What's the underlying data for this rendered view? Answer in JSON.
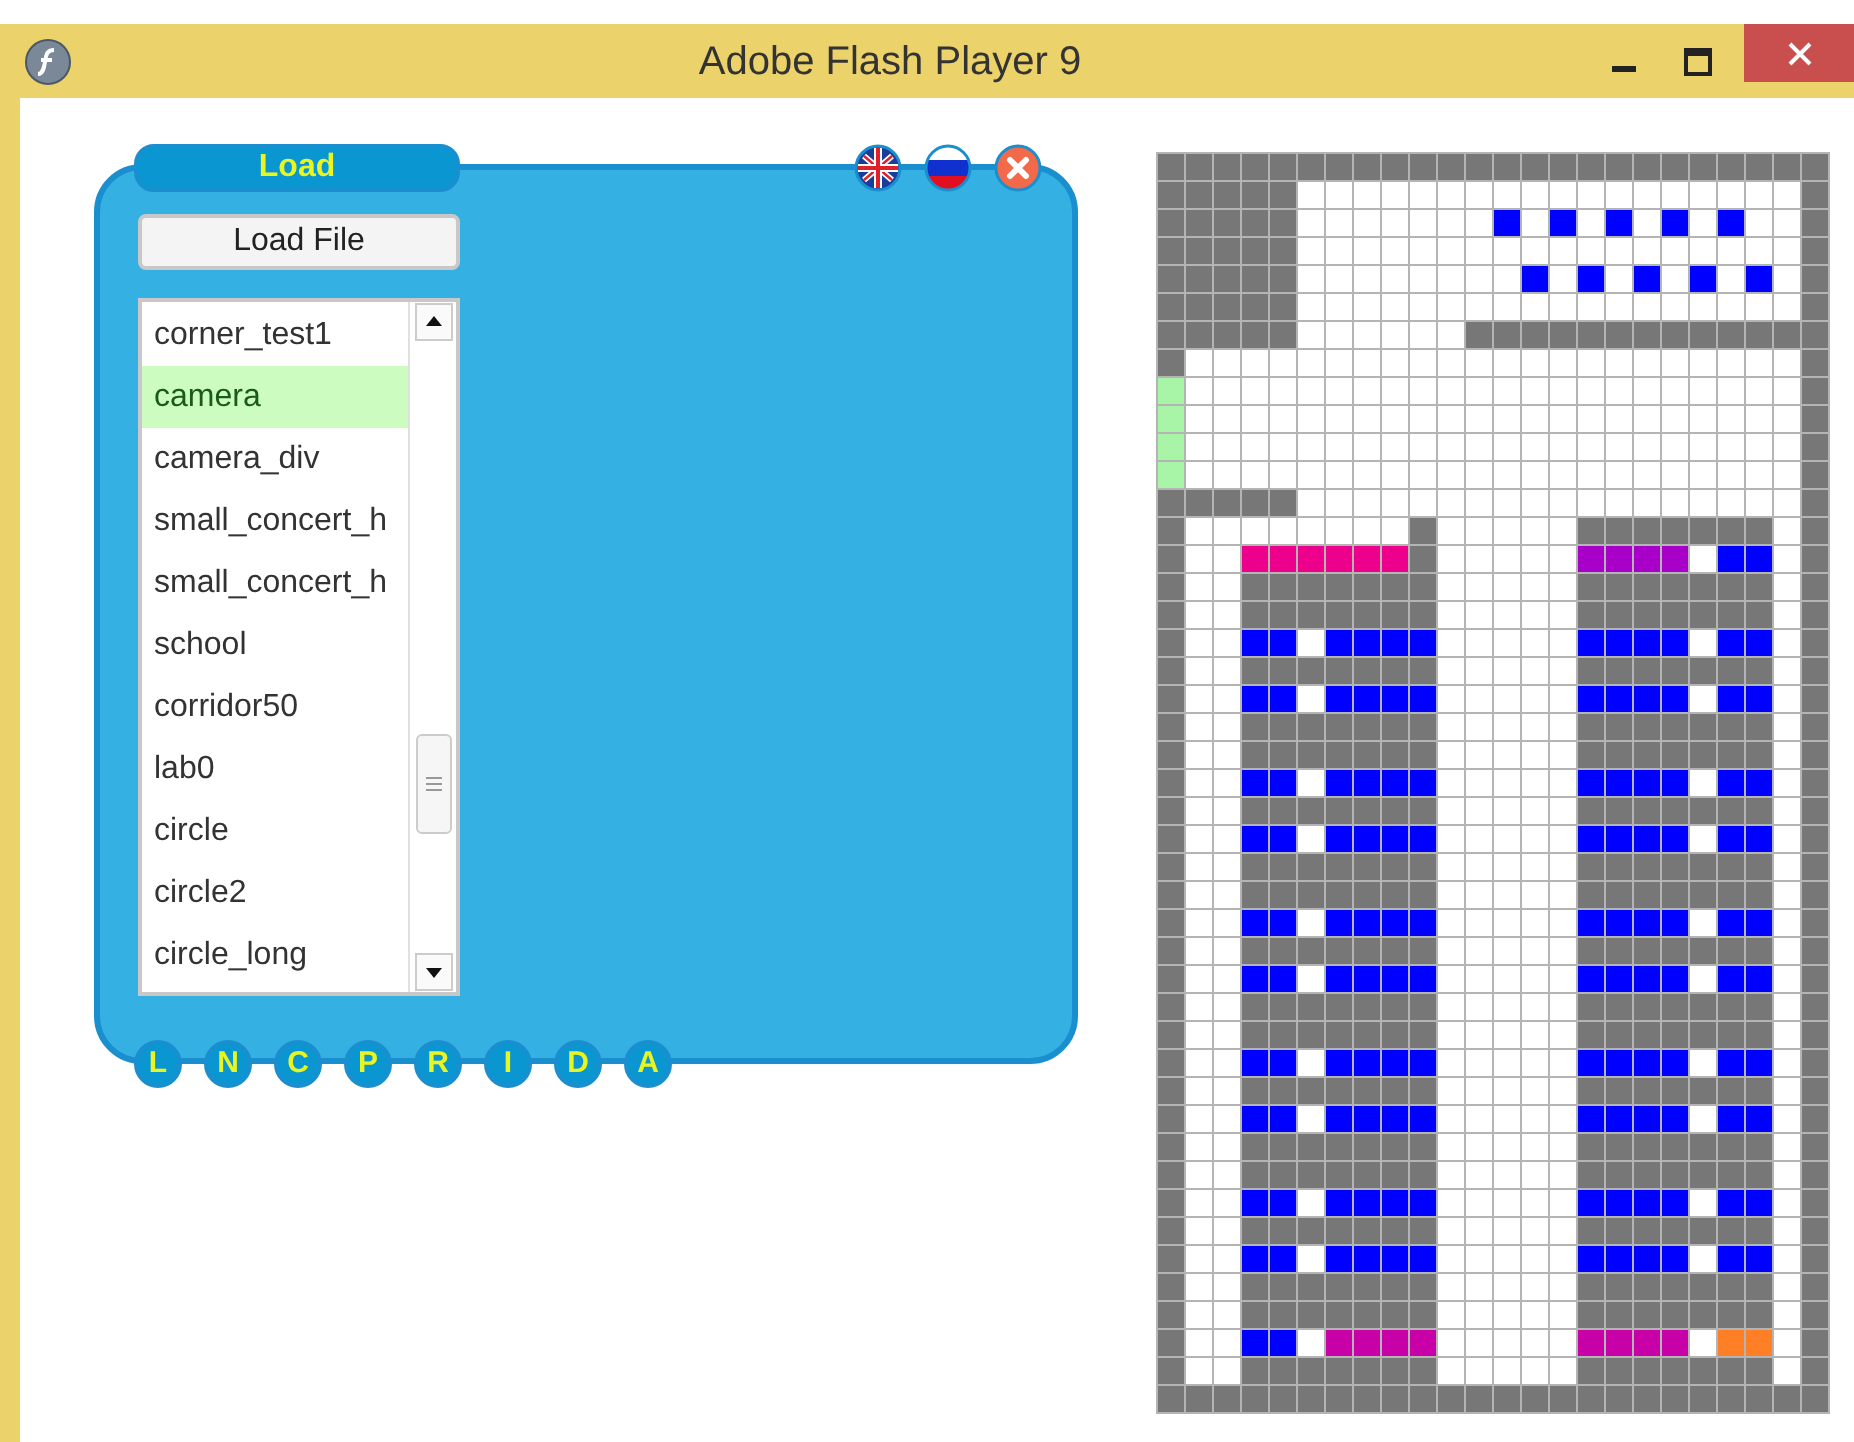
{
  "window": {
    "title": "Adobe Flash Player 9"
  },
  "panel": {
    "tab_label": "Load",
    "load_button": "Load File",
    "files": [
      {
        "name": "corner_test1",
        "selected": false
      },
      {
        "name": "camera",
        "selected": true
      },
      {
        "name": "camera_div",
        "selected": false
      },
      {
        "name": "small_concert_h",
        "selected": false
      },
      {
        "name": "small_concert_h",
        "selected": false
      },
      {
        "name": "school",
        "selected": false
      },
      {
        "name": "corridor50",
        "selected": false
      },
      {
        "name": "lab0",
        "selected": false
      },
      {
        "name": "circle",
        "selected": false
      },
      {
        "name": "circle2",
        "selected": false
      },
      {
        "name": "circle_long",
        "selected": false
      }
    ],
    "mode_tabs": [
      "L",
      "N",
      "C",
      "P",
      "R",
      "I",
      "D",
      "A"
    ]
  }
}
